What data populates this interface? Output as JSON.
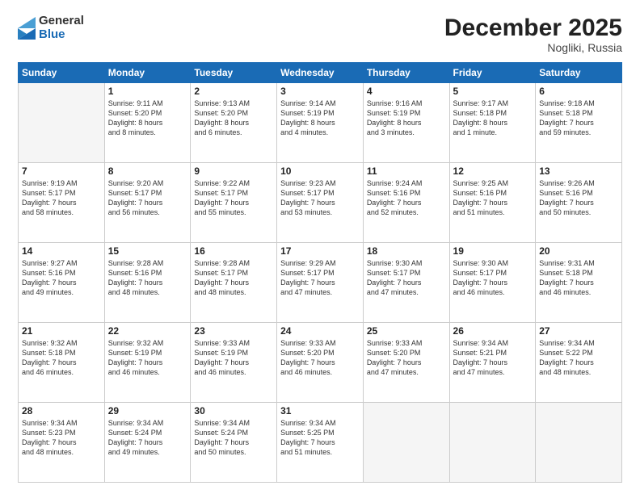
{
  "logo": {
    "general": "General",
    "blue": "Blue"
  },
  "title": "December 2025",
  "location": "Nogliki, Russia",
  "days_of_week": [
    "Sunday",
    "Monday",
    "Tuesday",
    "Wednesday",
    "Thursday",
    "Friday",
    "Saturday"
  ],
  "weeks": [
    [
      {
        "day": "",
        "info": ""
      },
      {
        "day": "1",
        "info": "Sunrise: 9:11 AM\nSunset: 5:20 PM\nDaylight: 8 hours\nand 8 minutes."
      },
      {
        "day": "2",
        "info": "Sunrise: 9:13 AM\nSunset: 5:20 PM\nDaylight: 8 hours\nand 6 minutes."
      },
      {
        "day": "3",
        "info": "Sunrise: 9:14 AM\nSunset: 5:19 PM\nDaylight: 8 hours\nand 4 minutes."
      },
      {
        "day": "4",
        "info": "Sunrise: 9:16 AM\nSunset: 5:19 PM\nDaylight: 8 hours\nand 3 minutes."
      },
      {
        "day": "5",
        "info": "Sunrise: 9:17 AM\nSunset: 5:18 PM\nDaylight: 8 hours\nand 1 minute."
      },
      {
        "day": "6",
        "info": "Sunrise: 9:18 AM\nSunset: 5:18 PM\nDaylight: 7 hours\nand 59 minutes."
      }
    ],
    [
      {
        "day": "7",
        "info": "Sunrise: 9:19 AM\nSunset: 5:17 PM\nDaylight: 7 hours\nand 58 minutes."
      },
      {
        "day": "8",
        "info": "Sunrise: 9:20 AM\nSunset: 5:17 PM\nDaylight: 7 hours\nand 56 minutes."
      },
      {
        "day": "9",
        "info": "Sunrise: 9:22 AM\nSunset: 5:17 PM\nDaylight: 7 hours\nand 55 minutes."
      },
      {
        "day": "10",
        "info": "Sunrise: 9:23 AM\nSunset: 5:17 PM\nDaylight: 7 hours\nand 53 minutes."
      },
      {
        "day": "11",
        "info": "Sunrise: 9:24 AM\nSunset: 5:16 PM\nDaylight: 7 hours\nand 52 minutes."
      },
      {
        "day": "12",
        "info": "Sunrise: 9:25 AM\nSunset: 5:16 PM\nDaylight: 7 hours\nand 51 minutes."
      },
      {
        "day": "13",
        "info": "Sunrise: 9:26 AM\nSunset: 5:16 PM\nDaylight: 7 hours\nand 50 minutes."
      }
    ],
    [
      {
        "day": "14",
        "info": "Sunrise: 9:27 AM\nSunset: 5:16 PM\nDaylight: 7 hours\nand 49 minutes."
      },
      {
        "day": "15",
        "info": "Sunrise: 9:28 AM\nSunset: 5:16 PM\nDaylight: 7 hours\nand 48 minutes."
      },
      {
        "day": "16",
        "info": "Sunrise: 9:28 AM\nSunset: 5:17 PM\nDaylight: 7 hours\nand 48 minutes."
      },
      {
        "day": "17",
        "info": "Sunrise: 9:29 AM\nSunset: 5:17 PM\nDaylight: 7 hours\nand 47 minutes."
      },
      {
        "day": "18",
        "info": "Sunrise: 9:30 AM\nSunset: 5:17 PM\nDaylight: 7 hours\nand 47 minutes."
      },
      {
        "day": "19",
        "info": "Sunrise: 9:30 AM\nSunset: 5:17 PM\nDaylight: 7 hours\nand 46 minutes."
      },
      {
        "day": "20",
        "info": "Sunrise: 9:31 AM\nSunset: 5:18 PM\nDaylight: 7 hours\nand 46 minutes."
      }
    ],
    [
      {
        "day": "21",
        "info": "Sunrise: 9:32 AM\nSunset: 5:18 PM\nDaylight: 7 hours\nand 46 minutes."
      },
      {
        "day": "22",
        "info": "Sunrise: 9:32 AM\nSunset: 5:19 PM\nDaylight: 7 hours\nand 46 minutes."
      },
      {
        "day": "23",
        "info": "Sunrise: 9:33 AM\nSunset: 5:19 PM\nDaylight: 7 hours\nand 46 minutes."
      },
      {
        "day": "24",
        "info": "Sunrise: 9:33 AM\nSunset: 5:20 PM\nDaylight: 7 hours\nand 46 minutes."
      },
      {
        "day": "25",
        "info": "Sunrise: 9:33 AM\nSunset: 5:20 PM\nDaylight: 7 hours\nand 47 minutes."
      },
      {
        "day": "26",
        "info": "Sunrise: 9:34 AM\nSunset: 5:21 PM\nDaylight: 7 hours\nand 47 minutes."
      },
      {
        "day": "27",
        "info": "Sunrise: 9:34 AM\nSunset: 5:22 PM\nDaylight: 7 hours\nand 48 minutes."
      }
    ],
    [
      {
        "day": "28",
        "info": "Sunrise: 9:34 AM\nSunset: 5:23 PM\nDaylight: 7 hours\nand 48 minutes."
      },
      {
        "day": "29",
        "info": "Sunrise: 9:34 AM\nSunset: 5:24 PM\nDaylight: 7 hours\nand 49 minutes."
      },
      {
        "day": "30",
        "info": "Sunrise: 9:34 AM\nSunset: 5:24 PM\nDaylight: 7 hours\nand 50 minutes."
      },
      {
        "day": "31",
        "info": "Sunrise: 9:34 AM\nSunset: 5:25 PM\nDaylight: 7 hours\nand 51 minutes."
      },
      {
        "day": "",
        "info": ""
      },
      {
        "day": "",
        "info": ""
      },
      {
        "day": "",
        "info": ""
      }
    ]
  ]
}
